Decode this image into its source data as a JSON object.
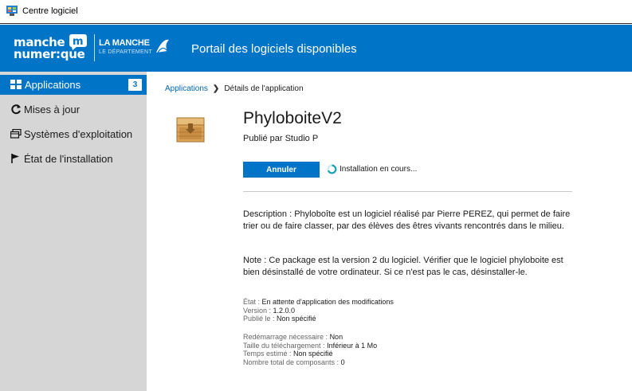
{
  "window": {
    "title": "Centre logiciel",
    "icon": "software-center-icon"
  },
  "banner": {
    "logo1": {
      "line1": "manche",
      "line2": "numer:que"
    },
    "logo2": {
      "line1": "LA MANCHE",
      "line2": "LE DÉPARTEMENT"
    },
    "portal_title": "Portail des logiciels disponibles",
    "color": "#0074c7"
  },
  "sidebar": {
    "items": [
      {
        "label": "Applications",
        "icon": "grid-icon",
        "badge": "3",
        "active": true
      },
      {
        "label": "Mises à jour",
        "icon": "refresh-icon",
        "active": false
      },
      {
        "label": "Systèmes d'exploitation",
        "icon": "window-icon",
        "active": false
      },
      {
        "label": "État de l'installation",
        "icon": "flag-icon",
        "active": false
      }
    ]
  },
  "breadcrumb": {
    "root": "Applications",
    "current": "Détails de l'application"
  },
  "app": {
    "name": "PhyloboiteV2",
    "publisher": "Publié par Studio P",
    "cancel_label": "Annuler",
    "status": "Installation en cours...",
    "description": "Description : Phyloboîte est un logiciel réalisé par Pierre PEREZ, qui permet de faire trier ou de faire classer, par des élèves des êtres vivants rencontrés dans le milieu.",
    "note": "Note : Ce package est la version 2 du logiciel. Vérifier que le logiciel phyloboite est bien désinstallé de votre ordinateur. Si ce n'est pas le cas, désinstaller-le."
  },
  "details": {
    "etat": {
      "label": "État : ",
      "value": "En attente d'application des modifications"
    },
    "version": {
      "label": "Version : ",
      "value": "1.2.0.0"
    },
    "publie": {
      "label": "Publié le : ",
      "value": "Non spécifié"
    },
    "redemarrage": {
      "label": "Redémarrage nécessaire : ",
      "value": "Non"
    },
    "taille": {
      "label": "Taille du téléchargement : ",
      "value": "Inférieur à 1 Mo"
    },
    "temps": {
      "label": "Temps estimé : ",
      "value": "Non spécifié"
    },
    "composants": {
      "label": "Nombre total de composants : ",
      "value": "0"
    }
  }
}
